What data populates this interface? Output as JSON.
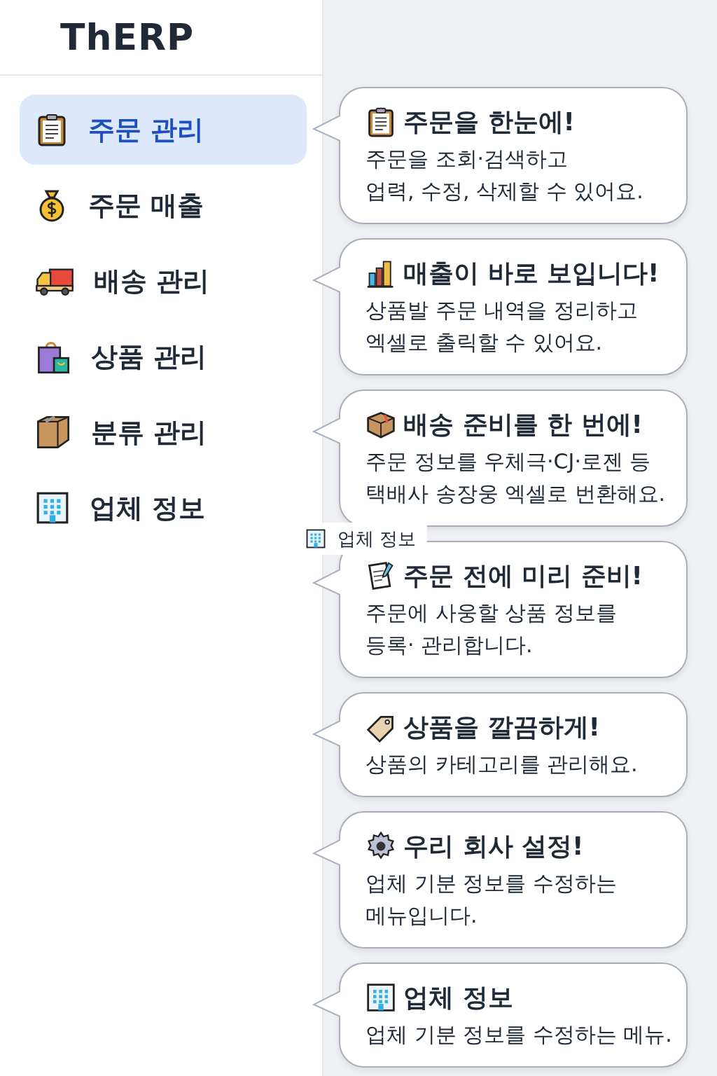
{
  "logo": "ThERP",
  "sidebar": {
    "items": [
      {
        "label": "주문 관리",
        "selected": true
      },
      {
        "label": "주문 매출",
        "selected": false
      },
      {
        "label": "배송 관리",
        "selected": false
      },
      {
        "label": "상품 관리",
        "selected": false
      },
      {
        "label": "분류 관리",
        "selected": false
      },
      {
        "label": "업체 정보",
        "selected": false
      }
    ]
  },
  "drag_preview": {
    "label": "업체 정보"
  },
  "tooltips": [
    {
      "title": "주문을 한눈에!",
      "lines": [
        "주문을 조회·검색하고",
        "업력, 수정, 삭제할  수  있어요."
      ]
    },
    {
      "title": "매출이 바로 보입니다!",
      "lines": [
        "상품발 주문 내역을 정리하고",
        "엑셀로 출릭할 수  있어요."
      ]
    },
    {
      "title": "배송 준비를 한 번에!",
      "lines": [
        "주문 정보를 우체극·CJ·로젠 등",
        "택배사 송장웅 엑셀로 번환해요."
      ]
    },
    {
      "title": "주문 전에 미리 준비!",
      "lines": [
        "주문에 사웅할 상품 정보를",
        "등록· 관리합니다."
      ]
    },
    {
      "title": "상품을 깔끔하게!",
      "lines": [
        "상품의 카테고리를  관리해요."
      ]
    },
    {
      "title": "우리 회사 설정!",
      "lines": [
        "업체 기분 정보를  수정하는",
        "메뉴입니다."
      ]
    },
    {
      "title": "업체 정보",
      "lines": [
        "업체 기분 정보를 수정하는 메뉴."
      ]
    }
  ]
}
